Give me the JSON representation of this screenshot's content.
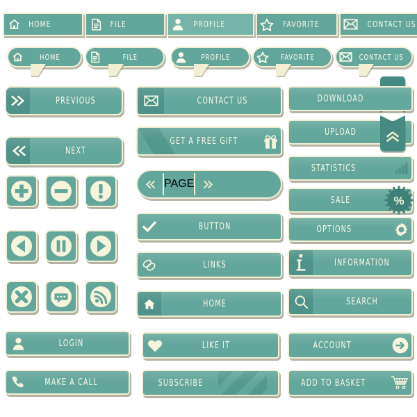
{
  "kit": {
    "title": "Retro Teal UI Button Kit",
    "palette": {
      "teal": "#63a69b",
      "teal_light": "#76b3a9",
      "teal_dark": "#4e9289",
      "cream": "#f2efd5",
      "shadow": "#8e8a6e",
      "background": "#ffffff"
    }
  },
  "navbar": {
    "items": [
      {
        "label": "HOME",
        "icon": "home-icon",
        "active": false
      },
      {
        "label": "FILE",
        "icon": "file-icon",
        "active": false
      },
      {
        "label": "PROFILE",
        "icon": "user-icon",
        "active": true
      },
      {
        "label": "FAVORITE",
        "icon": "star-icon",
        "active": false
      },
      {
        "label": "CONTACT US",
        "icon": "envelope-icon",
        "active": false
      }
    ]
  },
  "bubbles": {
    "items": [
      {
        "label": "HOME",
        "icon": "home-icon"
      },
      {
        "label": "FILE",
        "icon": "file-icon"
      },
      {
        "label": "PROFILE",
        "icon": "user-icon"
      },
      {
        "label": "FAVORITE",
        "icon": "star-icon"
      },
      {
        "label": "CONTACT US",
        "icon": "envelope-icon"
      }
    ]
  },
  "column_left": {
    "previous": {
      "label": "PREVIOUS",
      "icon": "double-chevron-right-icon"
    },
    "next": {
      "label": "NEXT",
      "icon": "double-chevron-left-icon"
    },
    "icon_grid": [
      {
        "icon": "plus-icon"
      },
      {
        "icon": "minus-icon"
      },
      {
        "icon": "exclamation-icon"
      },
      {
        "icon": "previous-arrow-icon"
      },
      {
        "icon": "pause-icon"
      },
      {
        "icon": "play-icon"
      },
      {
        "icon": "close-icon"
      },
      {
        "icon": "chat-icon"
      },
      {
        "icon": "rss-icon"
      }
    ],
    "login": {
      "label": "LOGIN",
      "icon": "user-icon"
    },
    "make_call": {
      "label": "MAKE A CALL",
      "icon": "phone-icon"
    }
  },
  "column_middle": {
    "contact_us": {
      "label": "CONTACT US",
      "icon": "envelope-icon"
    },
    "free_gift": {
      "label": "GET A FREE GIFT",
      "icon": "gift-icon"
    },
    "page": {
      "label": "PAGE",
      "prev_icon": "double-chevron-left-icon",
      "next_icon": "double-chevron-right-icon"
    },
    "button": {
      "label": "BUTTON",
      "icon": "check-icon"
    },
    "links": {
      "label": "LINKS",
      "icon": "chain-link-icon"
    },
    "home": {
      "label": "HOME",
      "icon": "home-icon"
    },
    "like_it": {
      "label": "LIKE IT",
      "icon": "heart-icon"
    },
    "subscribe": {
      "label": "SUBSCRIBE"
    }
  },
  "column_right": {
    "download": {
      "label": "DOWNLOAD",
      "icon": "double-chevron-down-icon"
    },
    "upload": {
      "label": "UPLOAD",
      "icon": "double-chevron-up-icon"
    },
    "statistics": {
      "label": "STATISTICS",
      "icon": "bar-chart-icon"
    },
    "sale": {
      "label": "SALE",
      "icon": "percent-badge-icon"
    },
    "options": {
      "label": "OPTIONS",
      "icon": "gear-icon"
    },
    "information": {
      "label": "INFORMATION",
      "icon": "info-icon"
    },
    "search": {
      "label": "SEARCH",
      "icon": "search-icon"
    },
    "account": {
      "label": "ACCOUNT",
      "icon": "arrow-right-circle-icon"
    },
    "add_basket": {
      "label": "ADD TO BASKET",
      "icon": "shopping-cart-icon"
    }
  }
}
